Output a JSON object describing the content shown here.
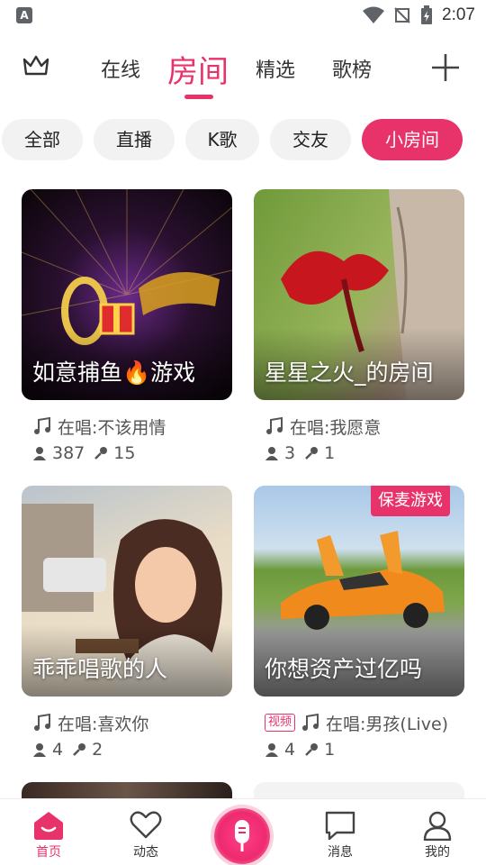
{
  "status": {
    "indicator": "A",
    "time": "2:07",
    "icons": [
      "wifi-icon",
      "signal-off-icon",
      "battery-charging-icon"
    ]
  },
  "nav": {
    "tabs": [
      {
        "label": "在线",
        "active": false
      },
      {
        "label": "房间",
        "active": true
      },
      {
        "label": "精选",
        "active": false
      },
      {
        "label": "歌榜",
        "active": false
      }
    ],
    "crown_icon": "crown-icon",
    "add_icon": "plus-icon"
  },
  "filters": [
    {
      "label": "全部",
      "active": false
    },
    {
      "label": "直播",
      "active": false
    },
    {
      "label": "K歌",
      "active": false
    },
    {
      "label": "交友",
      "active": false
    },
    {
      "label": "小房间",
      "active": true
    }
  ],
  "rooms": [
    {
      "title": "如意捕鱼🔥游戏",
      "singing_prefix": "在唱: ",
      "song": "不该用情",
      "users": "387",
      "mics": "15",
      "badge": "",
      "video": ""
    },
    {
      "title": "星星之火_的房间",
      "singing_prefix": "在唱: ",
      "song": "我愿意",
      "users": "3",
      "mics": "1",
      "badge": "",
      "video": ""
    },
    {
      "title": "乖乖唱歌的人",
      "singing_prefix": "在唱: ",
      "song": "喜欢你",
      "users": "4",
      "mics": "2",
      "badge": "",
      "video": ""
    },
    {
      "title": "你想资产过亿吗",
      "singing_prefix": "在唱: ",
      "song": "男孩(Live)",
      "users": "4",
      "mics": "1",
      "badge": "保麦游戏",
      "video": "视频"
    }
  ],
  "bottom_nav": [
    {
      "label": "首页",
      "icon": "home-icon",
      "active": true
    },
    {
      "label": "动态",
      "icon": "heart-icon",
      "active": false
    },
    {
      "label": "",
      "icon": "mic-icon",
      "active": false
    },
    {
      "label": "消息",
      "icon": "message-icon",
      "active": false
    },
    {
      "label": "我的",
      "icon": "profile-icon",
      "active": false
    }
  ],
  "colors": {
    "accent": "#e8336a",
    "chip_bg": "#f2f2f2"
  }
}
